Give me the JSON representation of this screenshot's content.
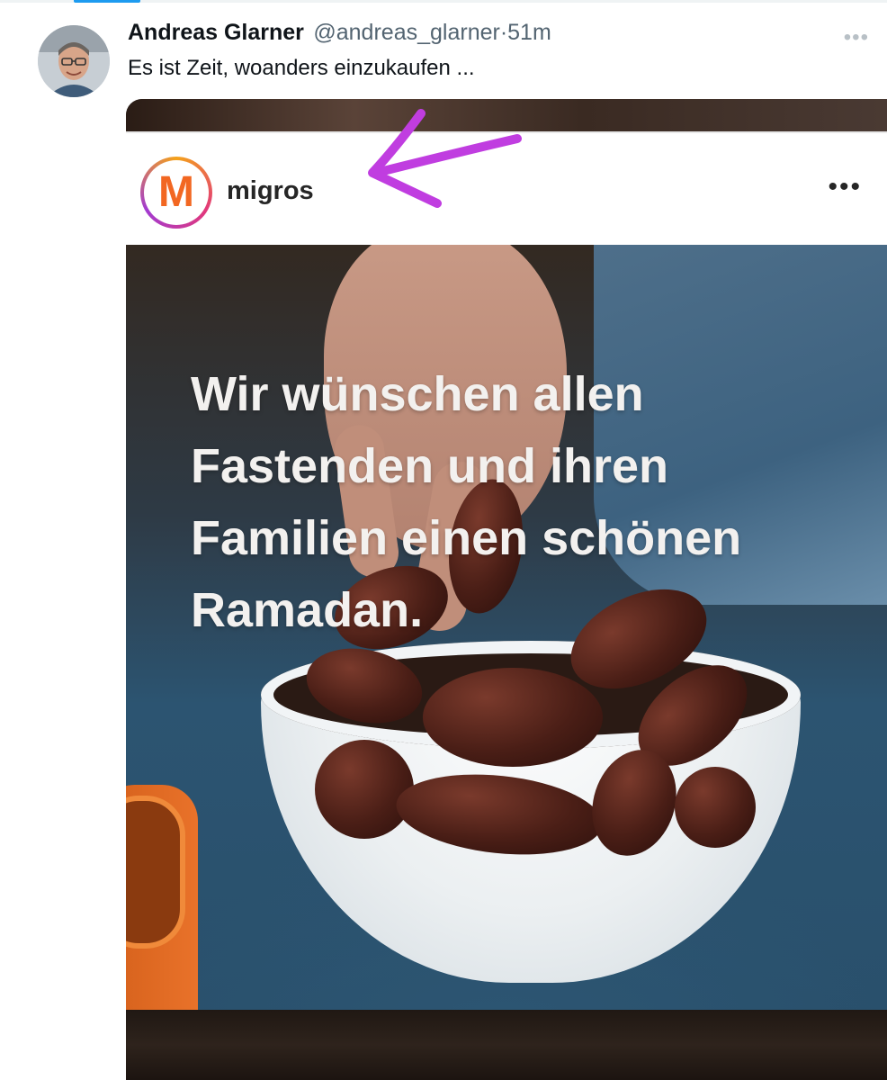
{
  "tweet": {
    "author_name": "Andreas Glarner",
    "handle": "@andreas_glarner",
    "separator": "·",
    "time": "51m",
    "text": "Es ist Zeit, woanders einzukaufen ..."
  },
  "embedded_post": {
    "logo_letter": "M",
    "account_name": "migros",
    "overlay_lines": [
      "Wir wünschen allen",
      "Fastenden und ihren",
      "Familien einen schönen",
      "Ramadan."
    ]
  },
  "icons": {
    "tweet_more": "more-horizontal-icon",
    "post_more": "more-horizontal-icon",
    "annotation": "arrow-annotation-icon"
  },
  "colors": {
    "accent": "#1d9bf0",
    "migros_orange": "#f26722",
    "annotation_purple": "#c03de0"
  }
}
